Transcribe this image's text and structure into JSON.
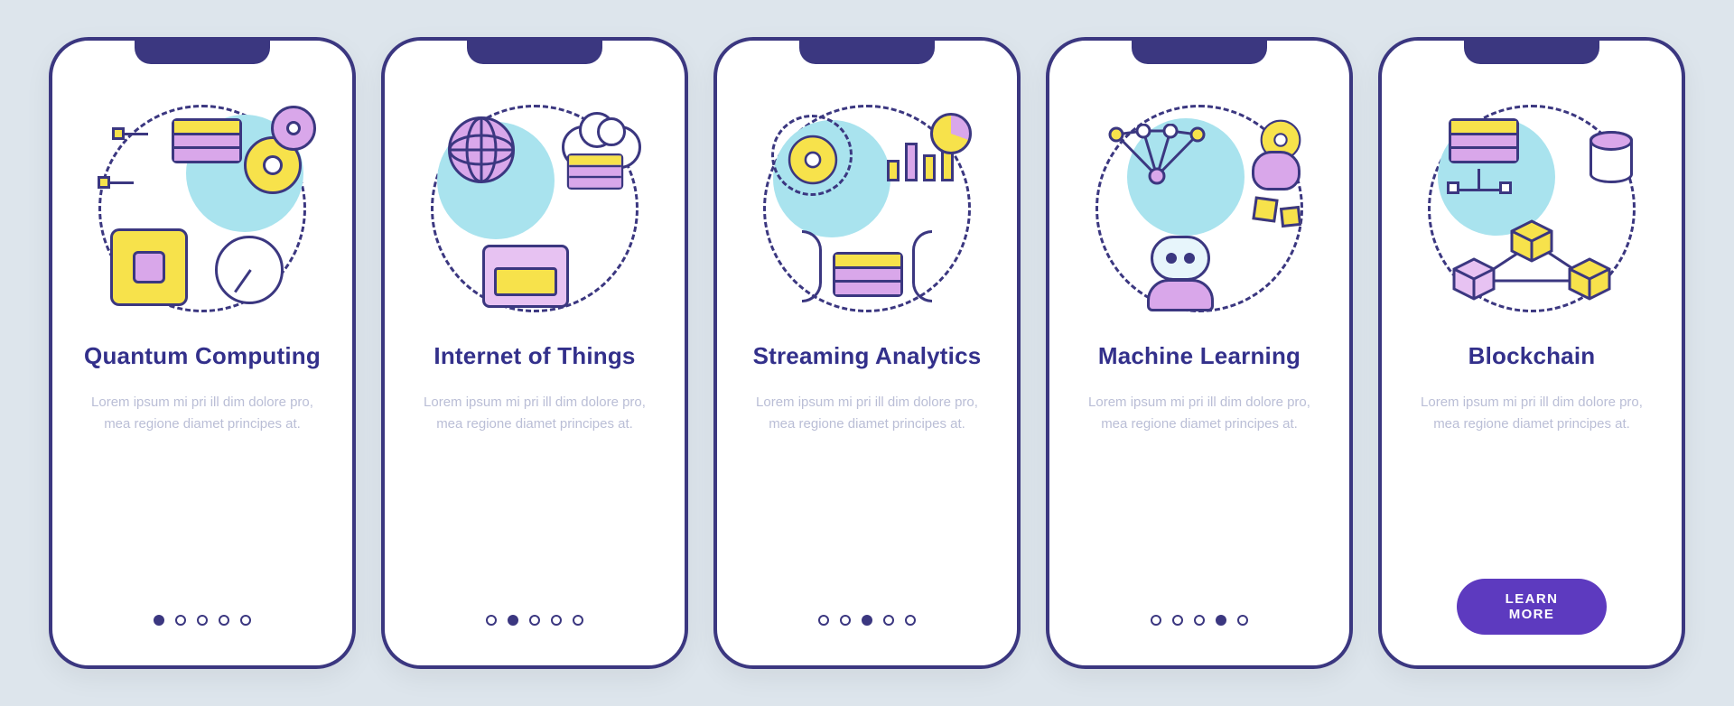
{
  "cards": [
    {
      "icon": "quantum-computing-icon",
      "title": "Quantum Computing",
      "body": "Lorem ipsum mi pri ill dim dolore pro, mea regione diamet principes at.",
      "active_index": 0,
      "button": null
    },
    {
      "icon": "iot-icon",
      "title": "Internet of Things",
      "body": "Lorem ipsum mi pri ill dim dolore pro, mea regione diamet principes at.",
      "active_index": 1,
      "button": null
    },
    {
      "icon": "streaming-analytics-icon",
      "title": "Streaming Analytics",
      "body": "Lorem ipsum mi pri ill dim dolore pro, mea regione diamet principes at.",
      "active_index": 2,
      "button": null
    },
    {
      "icon": "machine-learning-icon",
      "title": "Machine Learning",
      "body": "Lorem ipsum mi pri ill dim dolore pro, mea regione diamet principes at.",
      "active_index": 3,
      "button": null
    },
    {
      "icon": "blockchain-icon",
      "title": "Blockchain",
      "body": "Lorem ipsum mi pri ill dim dolore pro, mea regione diamet principes at.",
      "active_index": 4,
      "button": "LEARN MORE"
    }
  ],
  "dots_count": 5
}
